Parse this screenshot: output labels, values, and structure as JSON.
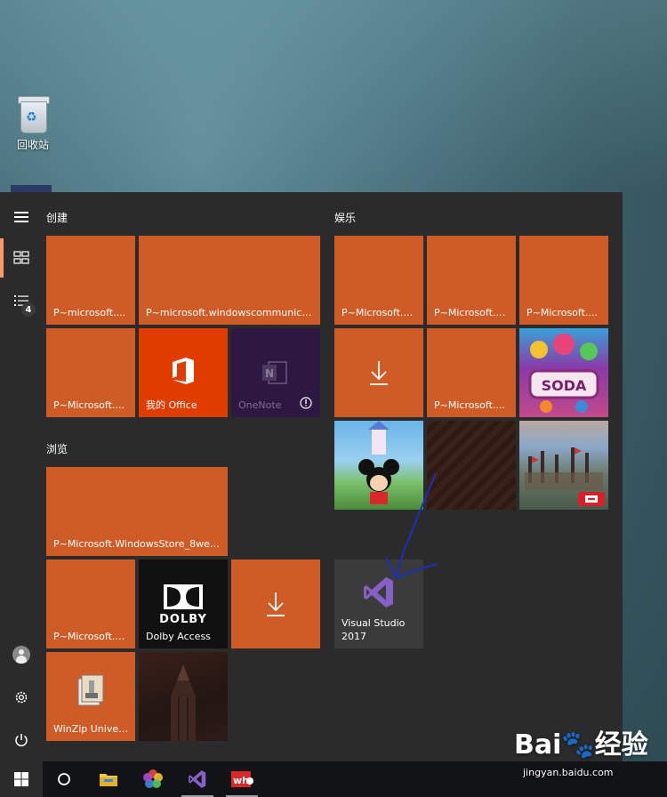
{
  "desktop": {
    "recycle_bin_label": "回收站"
  },
  "start_menu": {
    "rail": {
      "tiles_badge": "4"
    },
    "groups": [
      {
        "title": "创建"
      },
      {
        "title": "浏览"
      },
      {
        "title": "娱乐"
      }
    ],
    "tiles": {
      "create_1": "P~microsoft....",
      "create_2": "P~microsoft.windowscommunicat...",
      "create_3": "P~Microsoft....",
      "office": "我的 Office",
      "onenote": "OneNote",
      "browse_1": "P~Microsoft.WindowsStore_8wek...",
      "browse_2": "P~Microsoft.B...",
      "dolby": "Dolby Access",
      "dolby_logo": "DOLBY",
      "winzip": "WinZip Univer...",
      "ent_1": "P~Microsoft.X...",
      "ent_2": "P~Microsoft.Z...",
      "ent_3": "P~Microsoft....",
      "ent_4": "P~Microsoft....",
      "candy_text": "SODA",
      "vs_line1": "Visual Studio",
      "vs_line2": "2017"
    }
  },
  "watermark": {
    "brand": "Bai🐾经验",
    "url": "jingyan.baidu.com"
  },
  "colors": {
    "tile_orange": "#cf5c27",
    "office_red": "#e03c00",
    "onenote_purple": "#2c1840",
    "rail_accent": "#ff9966"
  }
}
